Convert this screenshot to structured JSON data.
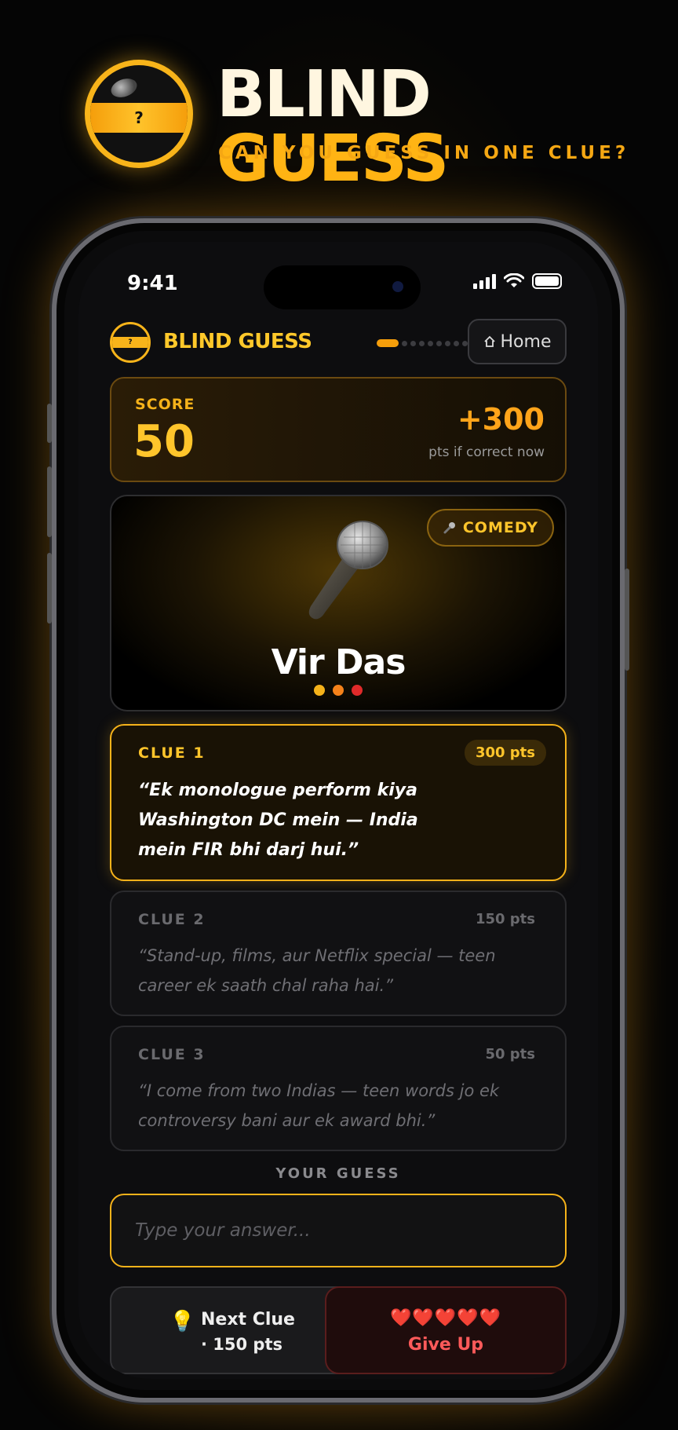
{
  "poster": {
    "title_part1": "BLIND",
    "title_part2": "GUESS",
    "tagline": "CAN YOU GUESS IN ONE CLUE?",
    "logo_glyph": "?"
  },
  "status_bar": {
    "time": "9:41"
  },
  "app_bar": {
    "app_name": "BLIND GUESS",
    "logo_glyph": "?",
    "home_label": "Home",
    "home_icon": "home-icon",
    "progress_current": 1,
    "progress_total": 10
  },
  "score": {
    "label": "SCORE",
    "value": "50",
    "potential": "+300",
    "potential_sub": "pts if correct now"
  },
  "hero": {
    "category": "COMEDY",
    "category_icon": "microphone-icon",
    "name": "Vir Das",
    "dot_colors": [
      "#f5b21a",
      "#f5821a",
      "#e02a2a"
    ]
  },
  "clues": [
    {
      "label": "CLUE 1",
      "points": "300 pts",
      "text": "“Ek monologue perform kiya Washington DC mein — India mein FIR bhi darj hui.”",
      "state": "active"
    },
    {
      "label": "CLUE 2",
      "points": "150 pts",
      "text": "“Stand-up, films, aur Netflix special — teen career ek saath chal raha hai.”",
      "state": "locked"
    },
    {
      "label": "CLUE 3",
      "points": "50 pts",
      "text": "“I come from two Indias — teen words jo ek controversy bani aur ek award bhi.”",
      "state": "locked"
    }
  ],
  "guess": {
    "label": "YOUR GUESS",
    "placeholder": "Type your answer...",
    "value": ""
  },
  "actions": {
    "next_line1": "Next Clue",
    "next_line2": "· 150 pts",
    "next_icon": "lightbulb-icon",
    "give_up_hearts": "❤️❤️❤️❤️❤️",
    "give_up_label": "Give Up"
  },
  "colors": {
    "accent": "#f5b21a",
    "danger": "#ff5a5a"
  }
}
